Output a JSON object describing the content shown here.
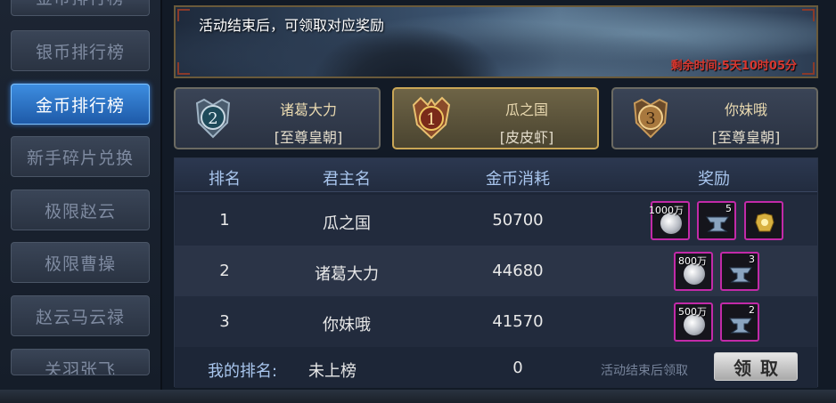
{
  "sidebar": {
    "items": [
      {
        "label": "金币排行榜",
        "state": "partial-top"
      },
      {
        "label": "银币排行榜",
        "state": "normal"
      },
      {
        "label": "金币排行榜",
        "state": "active"
      },
      {
        "label": "新手碎片兑换",
        "state": "normal"
      },
      {
        "label": "极限赵云",
        "state": "normal"
      },
      {
        "label": "极限曹操",
        "state": "normal"
      },
      {
        "label": "赵云马云禄",
        "state": "normal"
      },
      {
        "label": "关羽张飞",
        "state": "partial-bottom"
      }
    ]
  },
  "banner": {
    "text": "活动结束后，可领取对应奖励",
    "time_left": "剩余时间:5天10时05分"
  },
  "podium": [
    {
      "rank": "2",
      "name": "诸葛大力",
      "tag": "[至尊皇朝]",
      "medal_icon": "silver-medal-icon"
    },
    {
      "rank": "1",
      "name": "瓜之国",
      "tag": "[皮皮虾]",
      "medal_icon": "gold-medal-icon"
    },
    {
      "rank": "3",
      "name": "你妹哦",
      "tag": "[至尊皇朝]",
      "medal_icon": "bronze-medal-icon"
    }
  ],
  "table": {
    "headers": {
      "rank": "排名",
      "name": "君主名",
      "spent": "金币消耗",
      "reward": "奖励"
    },
    "rows": [
      {
        "rank": "1",
        "name": "瓜之国",
        "spent": "50700",
        "rewards": [
          {
            "icon": "silver-coin-icon",
            "label": "1000万"
          },
          {
            "icon": "anvil-icon",
            "label": "5"
          },
          {
            "icon": "golden-armor-icon",
            "label": ""
          }
        ]
      },
      {
        "rank": "2",
        "name": "诸葛大力",
        "spent": "44680",
        "rewards": [
          {
            "icon": "silver-coin-icon",
            "label": "800万"
          },
          {
            "icon": "anvil-icon",
            "label": "3"
          }
        ]
      },
      {
        "rank": "3",
        "name": "你妹哦",
        "spent": "41570",
        "rewards": [
          {
            "icon": "silver-coin-icon",
            "label": "500万"
          },
          {
            "icon": "anvil-icon",
            "label": "2"
          }
        ]
      }
    ]
  },
  "footer": {
    "my_rank_label": "我的排名:",
    "my_rank_value": "未上榜",
    "my_spent": "0",
    "claim_note": "活动结束后领取",
    "claim_button": "领取"
  },
  "colors": {
    "accent_blue": "#3d8de0",
    "gold_border": "#c9a656",
    "reward_border": "#c22aa8",
    "time_red": "#d8372f"
  }
}
